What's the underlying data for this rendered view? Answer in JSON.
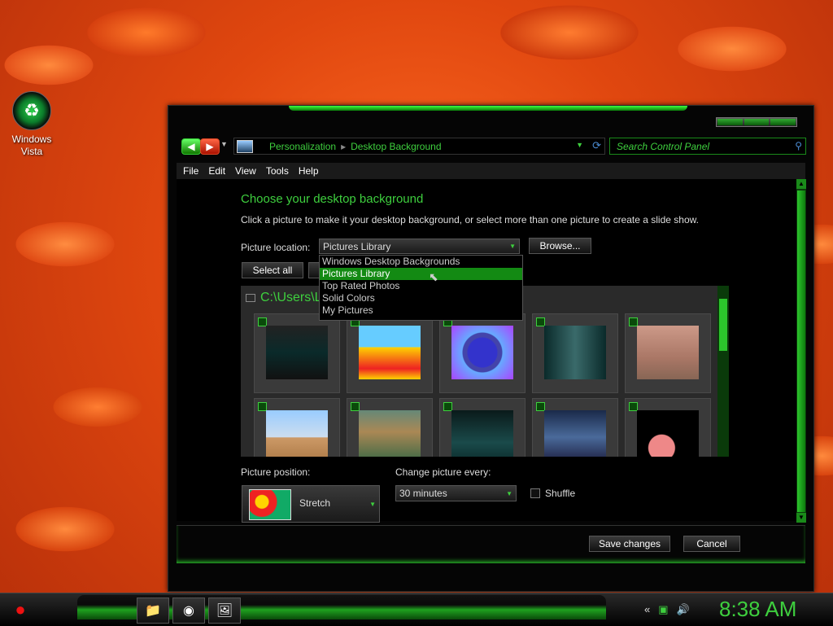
{
  "desktop": {
    "icon_label": "Windows Vista"
  },
  "addressbar": {
    "crumb1": "Personalization",
    "crumb2": "Desktop Background",
    "search_placeholder": "Search Control Panel"
  },
  "menu": [
    "File",
    "Edit",
    "View",
    "Tools",
    "Help"
  ],
  "content": {
    "heading": "Choose your desktop background",
    "subtext": "Click a picture to make it your desktop background, or select more than one picture to create a slide show.",
    "location_label": "Picture location:",
    "location_value": "Pictures Library",
    "browse": "Browse...",
    "select_all": "Select all",
    "dropdown": [
      "Windows Desktop Backgrounds",
      "Pictures Library",
      "Top Rated Photos",
      "Solid Colors",
      "My Pictures"
    ],
    "folder": "C:\\Users\\L",
    "position_label": "Picture position:",
    "position_value": "Stretch",
    "change_label": "Change picture every:",
    "change_value": "30 minutes",
    "shuffle": "Shuffle"
  },
  "buttons": {
    "save": "Save changes",
    "cancel": "Cancel"
  },
  "taskbar": {
    "clock": "8:38 AM"
  },
  "colors": {
    "accent": "#3ecf3e",
    "highlight": "#138a13"
  }
}
